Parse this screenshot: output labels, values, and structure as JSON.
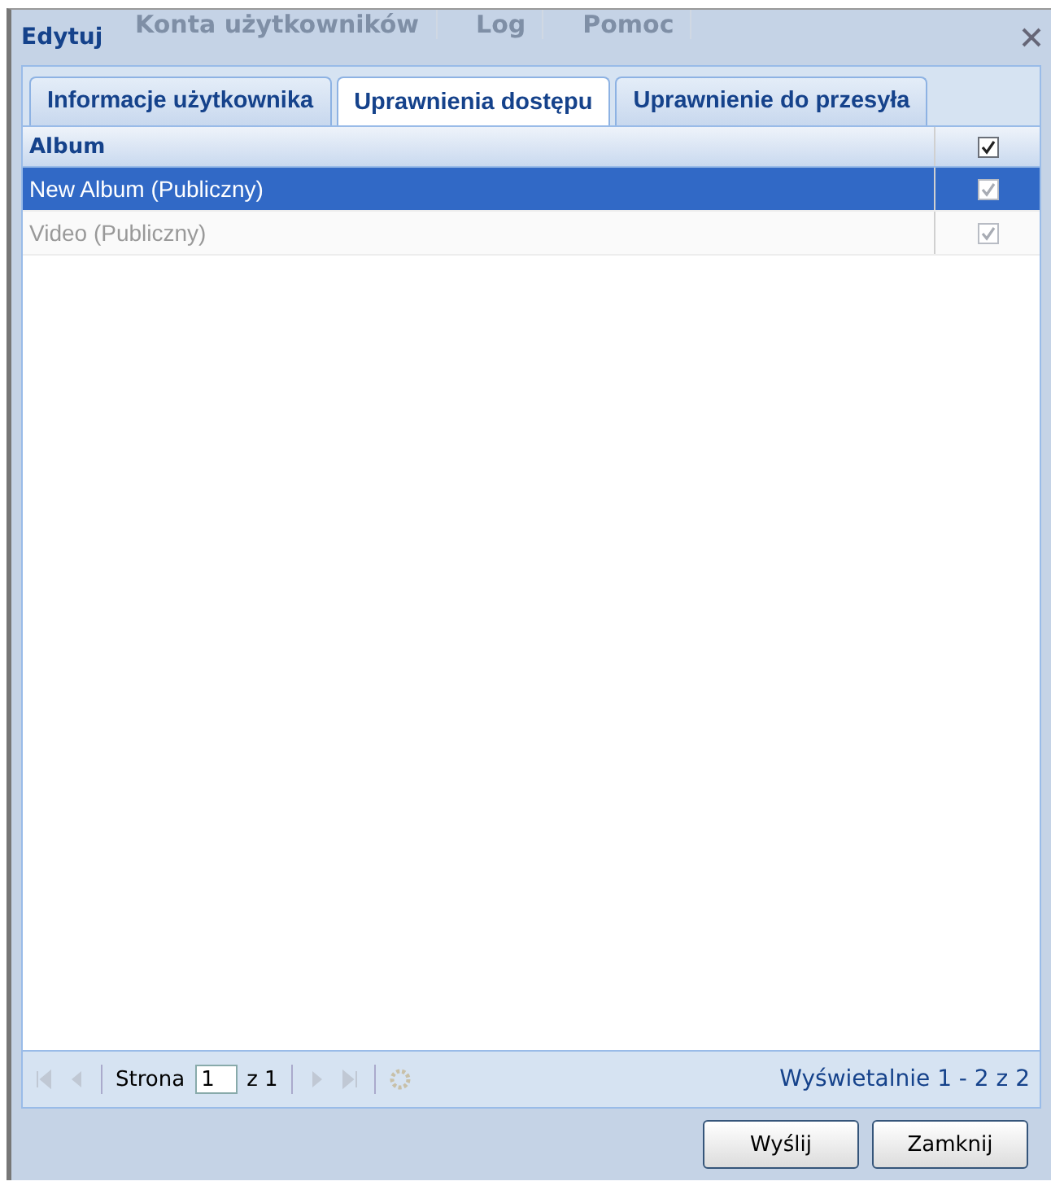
{
  "window": {
    "title": "Edytuj"
  },
  "background_menu": [
    "Konta użytkowników",
    "Log",
    "Pomoc"
  ],
  "tabs": [
    {
      "label": "Informacje użytkownika",
      "selected": false
    },
    {
      "label": "Uprawnienia dostępu",
      "selected": true
    },
    {
      "label": "Uprawnienie do przesyła",
      "selected": false
    }
  ],
  "table": {
    "columns": [
      {
        "label": "Album"
      },
      {
        "checked": true
      }
    ],
    "rows": [
      {
        "album": "New Album (Publiczny)",
        "checked": true,
        "selected": true,
        "disabled": false
      },
      {
        "album": "Video (Publiczny)",
        "checked": true,
        "selected": false,
        "disabled": true
      }
    ]
  },
  "pager": {
    "page_label": "Strona",
    "page": "1",
    "of_label": "z 1",
    "summary": "Wyświetalnie 1 - 2 z 2"
  },
  "buttons": [
    "Wyślij",
    "Zamknij"
  ]
}
